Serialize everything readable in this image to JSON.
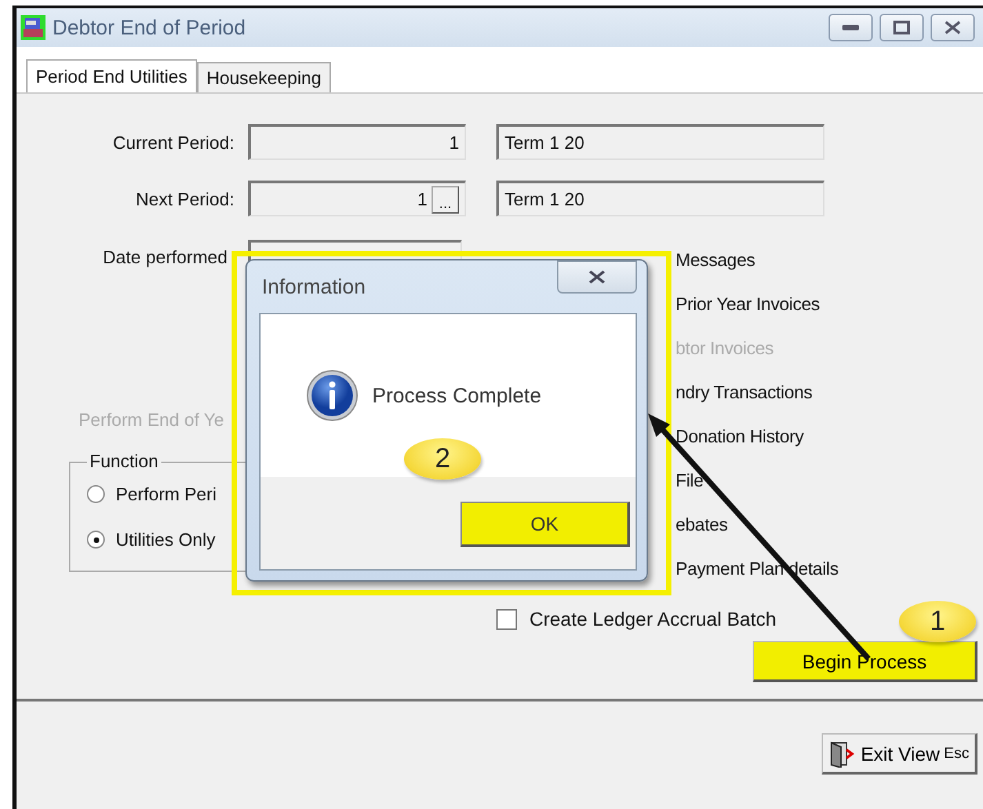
{
  "window": {
    "title": "Debtor End of Period"
  },
  "tabs": [
    {
      "label": "Period End Utilities",
      "selected": true
    },
    {
      "label": "Housekeeping",
      "selected": false
    }
  ],
  "fields": [
    {
      "label": "Current Period:",
      "value": "1",
      "description": "Term 1 20"
    },
    {
      "label": "Next Period:",
      "value": "1",
      "description": "Term 1 20",
      "lookup_label": "..."
    }
  ],
  "date_performed": {
    "label": "Date performed"
  },
  "year_end_option": {
    "label": "Perform End of Ye",
    "disabled": true
  },
  "function_group": {
    "title": "Function",
    "options": [
      {
        "label": "Perform Peri",
        "selected": false
      },
      {
        "label": "Utilities Only",
        "selected": true
      }
    ]
  },
  "options": [
    {
      "label": "Messages",
      "disabled": false
    },
    {
      "label": "Prior Year Invoices",
      "disabled": false
    },
    {
      "label": "btor Invoices",
      "disabled": true
    },
    {
      "label": "ndry Transactions",
      "disabled": false
    },
    {
      "label": "Donation History",
      "disabled": false
    },
    {
      "label": "File",
      "disabled": false
    },
    {
      "label": "ebates",
      "disabled": false
    },
    {
      "label": "Payment Plan details",
      "disabled": false
    }
  ],
  "accrual": {
    "label": "Create Ledger Accrual Batch",
    "checked": false
  },
  "begin_button": {
    "label": "Begin Process"
  },
  "exit_button": {
    "label": "Exit View",
    "shortcut": "Esc"
  },
  "dialog": {
    "title": "Information",
    "message": "Process Complete",
    "ok_label": "OK"
  },
  "callouts": [
    {
      "label": "1"
    },
    {
      "label": "2"
    }
  ]
}
